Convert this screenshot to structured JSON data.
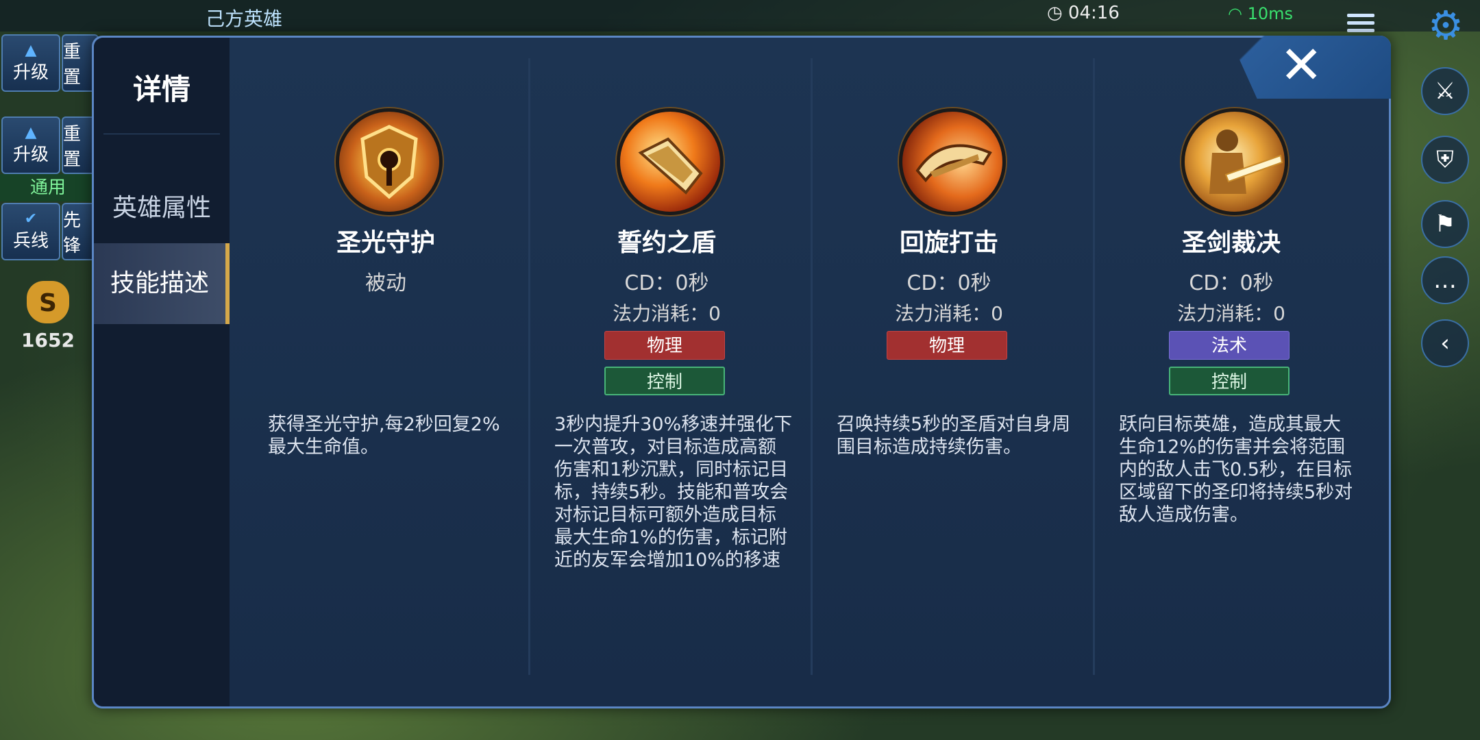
{
  "hud": {
    "ally_heroes_title": "己方英雄",
    "upgrade_label": "升级",
    "reset_label": "重置",
    "general_label": "通用",
    "minion_label": "兵线",
    "vanguard_label": "先锋",
    "gold": "1652",
    "gold_symbol": "S",
    "clock": "04:16",
    "ping": "10ms"
  },
  "dialog": {
    "sidebar": {
      "title": "详情",
      "items": [
        {
          "label": "英雄属性",
          "active": false
        },
        {
          "label": "技能描述",
          "active": true
        }
      ]
    },
    "close_symbol": "✕",
    "skills": [
      {
        "name": "圣光守护",
        "subtitle": "被动",
        "cd": "",
        "mana": "",
        "tags": [],
        "description": "获得圣光守护,每2秒回复2%最大生命值。",
        "icon": "shield-emblem-icon"
      },
      {
        "name": "誓约之盾",
        "subtitle": "CD：0秒",
        "mana": "法力消耗：0",
        "tags": [
          {
            "label": "物理",
            "kind": "phys"
          },
          {
            "label": "控制",
            "kind": "ctrl"
          }
        ],
        "description": "3秒内提升30%移速并强化下一次普攻，对目标造成高额伤害和1秒沉默，同时标记目标，持续5秒。技能和普攻会对标记目标可额外造成目标最大生命1%的伤害，标记附近的友军会增加10%的移速",
        "icon": "flaming-shield-icon"
      },
      {
        "name": "回旋打击",
        "subtitle": "CD：0秒",
        "mana": "法力消耗：0",
        "tags": [
          {
            "label": "物理",
            "kind": "phys"
          }
        ],
        "description": "召唤持续5秒的圣盾对自身周围目标造成持续伤害。",
        "icon": "spinning-shield-icon"
      },
      {
        "name": "圣剑裁决",
        "subtitle": "CD：0秒",
        "mana": "法力消耗：0",
        "tags": [
          {
            "label": "法术",
            "kind": "magic"
          },
          {
            "label": "控制",
            "kind": "ctrl"
          }
        ],
        "description": "跃向目标英雄，造成其最大生命12%的伤害并会将范围内的敌人击飞0.5秒，在目标区域留下的圣印将持续5秒对敌人造成伤害。",
        "icon": "holy-sword-warrior-icon"
      }
    ]
  }
}
